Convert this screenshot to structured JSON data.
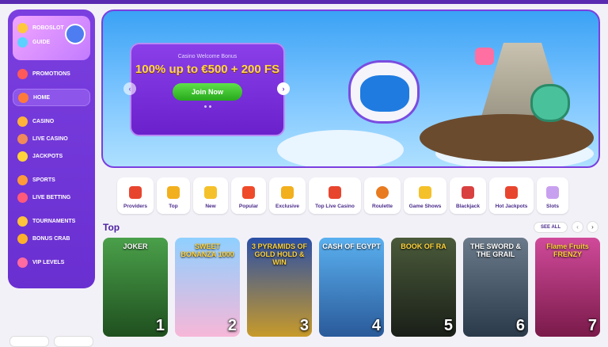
{
  "sidebar": {
    "brand": "ROBOSLOT",
    "guide": "GUIDE",
    "items": [
      {
        "label": "PROMOTIONS",
        "icon": "gift-icon"
      },
      {
        "label": "HOME",
        "icon": "home-icon"
      },
      {
        "label": "CASINO",
        "icon": "cards-icon"
      },
      {
        "label": "LIVE CASINO",
        "icon": "dealer-icon"
      },
      {
        "label": "JACKPOTS",
        "icon": "jackpot-icon"
      },
      {
        "label": "SPORTS",
        "icon": "ball-icon"
      },
      {
        "label": "LIVE BETTING",
        "icon": "live-icon"
      },
      {
        "label": "TOURNAMENTS",
        "icon": "trophy-icon"
      },
      {
        "label": "BONUS CRAB",
        "icon": "crab-icon"
      },
      {
        "label": "VIP LEVELS",
        "icon": "vip-icon"
      }
    ]
  },
  "hero": {
    "subtitle": "Casino Welcome Bonus",
    "headline": "100% up to €500 + 200 FS",
    "cta": "Join Now",
    "prev": "‹",
    "next": "›"
  },
  "categories": [
    {
      "label": "Providers",
      "color": "#e8452f"
    },
    {
      "label": "Top",
      "color": "#f2b01e"
    },
    {
      "label": "New",
      "color": "#f5c12a"
    },
    {
      "label": "Popular",
      "color": "#ef4a2a"
    },
    {
      "label": "Exclusive",
      "color": "#f2b01e"
    },
    {
      "label": "Top Live Casino",
      "color": "#e8452f"
    },
    {
      "label": "Roulette",
      "color": "#e87a1f"
    },
    {
      "label": "Game Shows",
      "color": "#f5c12a"
    },
    {
      "label": "Blackjack",
      "color": "#d94040"
    },
    {
      "label": "Hot Jackpots",
      "color": "#e8452f"
    },
    {
      "label": "Slots",
      "color": "#c8a0f0"
    }
  ],
  "section": {
    "title": "Top",
    "see_all": "SEE ALL",
    "prev": "‹",
    "next": "›"
  },
  "games": [
    {
      "title": "JOKER",
      "num": "1",
      "bg": "#3d8a3a"
    },
    {
      "title": "SWEET BONANZA 1000",
      "num": "2",
      "bg": "#6fb6ef"
    },
    {
      "title": "3 PYRAMIDS OF GOLD HOLD & WIN",
      "num": "3",
      "bg": "#2a4fa6"
    },
    {
      "title": "CASH OF EGYPT",
      "num": "4",
      "bg": "#3a8fd0"
    },
    {
      "title": "BOOK OF RA",
      "num": "5",
      "bg": "#2e3a2a"
    },
    {
      "title": "THE SWORD & THE GRAIL",
      "num": "6",
      "bg": "#4a5a6a"
    },
    {
      "title": "Flame Fruits FRENZY",
      "num": "7",
      "bg": "#b02a7a"
    }
  ]
}
